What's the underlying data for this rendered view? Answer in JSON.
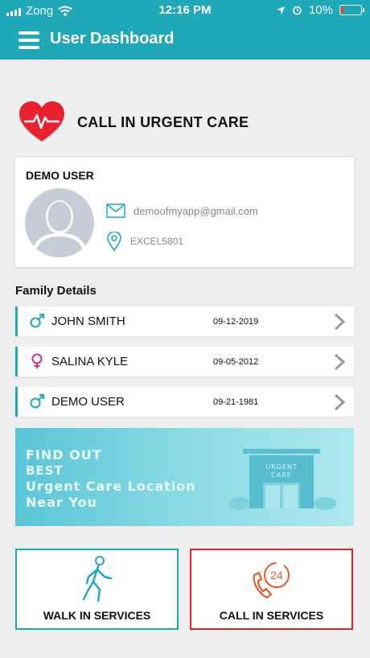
{
  "status_bar": {
    "carrier": "Zong",
    "time": "12:16 PM",
    "battery": "10%"
  },
  "header": {
    "title": "User Dashboard"
  },
  "urgent": {
    "title": "CALL IN URGENT CARE"
  },
  "user": {
    "name": "DEMO USER",
    "email": "demoofmyapp@gmail.com",
    "location": "EXCEL5801"
  },
  "family": {
    "title": "Family Details",
    "members": [
      {
        "name": "JOHN SMITH",
        "date": "09-12-2019",
        "gender": "male"
      },
      {
        "name": "SALINA KYLE",
        "date": "09-05-2012",
        "gender": "female"
      },
      {
        "name": "DEMO USER",
        "date": "09-21-1981",
        "gender": "male"
      }
    ]
  },
  "banner": {
    "line1": "FIND OUT",
    "line2": "BEST",
    "line3": "Urgent Care Location",
    "line4": "Near You",
    "sign1": "URGENT",
    "sign2": "CARE"
  },
  "services": {
    "walk_in": "WALK IN SERVICES",
    "call_in": "CALL IN SERVICES",
    "call_badge": "24"
  },
  "colors": {
    "primary": "#1fa8b8",
    "danger": "#e02424",
    "female": "#e0307a",
    "male": "#1fa8b8"
  }
}
